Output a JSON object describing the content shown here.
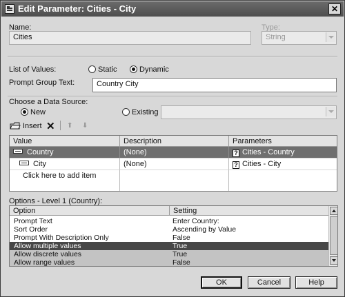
{
  "window": {
    "title": "Edit Parameter: Cities - City",
    "close_glyph": "✕"
  },
  "name": {
    "label": "Name:",
    "value": "Cities"
  },
  "type": {
    "label": "Type:",
    "value": "String"
  },
  "list_of_values": {
    "label": "List of Values:",
    "static_label": "Static",
    "dynamic_label": "Dynamic",
    "selected": "Dynamic"
  },
  "prompt_group": {
    "label": "Prompt Group Text:",
    "value": "Country City"
  },
  "data_source": {
    "label": "Choose a Data Source:",
    "new_label": "New",
    "existing_label": "Existing",
    "selected": "New",
    "existing_value": ""
  },
  "toolbar": {
    "insert_label": "Insert",
    "delete_glyph": "✕",
    "up_glyph": "⬆",
    "down_glyph": "⬇"
  },
  "values_grid": {
    "columns": [
      "Value",
      "Description",
      "Parameters"
    ],
    "rows": [
      {
        "value": "Country",
        "description": "(None)",
        "parameter": "Cities - Country",
        "selected": true
      },
      {
        "value": "City",
        "description": "(None)",
        "parameter": "Cities - City",
        "selected": false
      }
    ],
    "add_row_text": "Click here to add item",
    "param_icon_glyph": "?"
  },
  "options": {
    "label": "Options - Level 1 (Country):",
    "columns": [
      "Option",
      "Setting"
    ],
    "rows": [
      {
        "option": "Prompt Text",
        "setting": "Enter Country:",
        "state": "normal"
      },
      {
        "option": "Sort Order",
        "setting": "Ascending by Value",
        "state": "normal"
      },
      {
        "option": "Prompt With Description Only",
        "setting": "False",
        "state": "normal"
      },
      {
        "option": "Allow multiple values",
        "setting": "True",
        "state": "selected"
      },
      {
        "option": "Allow discrete values",
        "setting": "True",
        "state": "highlight"
      },
      {
        "option": "Allow range values",
        "setting": "False",
        "state": "highlight"
      }
    ]
  },
  "buttons": {
    "ok": "OK",
    "cancel": "Cancel",
    "help": "Help"
  }
}
